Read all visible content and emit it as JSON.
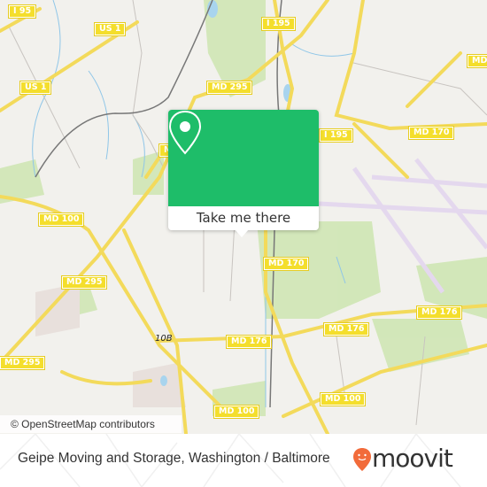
{
  "map": {
    "attribution": "© OpenStreetMap contributors",
    "road_labels": [
      {
        "id": "i95",
        "text": "I 95"
      },
      {
        "id": "us1-top",
        "text": "US 1"
      },
      {
        "id": "us1-left",
        "text": "US 1"
      },
      {
        "id": "md295-top",
        "text": "MD 295"
      },
      {
        "id": "i195-top",
        "text": "I 195"
      },
      {
        "id": "i195-mid",
        "text": "I 195"
      },
      {
        "id": "md170-right",
        "text": "MD 170"
      },
      {
        "id": "md-edge",
        "text": "MD"
      },
      {
        "id": "md-partial",
        "text": "M"
      },
      {
        "id": "md100-left",
        "text": "MD 100"
      },
      {
        "id": "md295-mid",
        "text": "MD 295"
      },
      {
        "id": "md170-center",
        "text": "MD 170"
      },
      {
        "id": "md176-right",
        "text": "MD 176"
      },
      {
        "id": "md176-mid",
        "text": "MD 176"
      },
      {
        "id": "md176-center",
        "text": "MD 176"
      },
      {
        "id": "md295-bottom",
        "text": "MD 295"
      },
      {
        "id": "md100-bottom-right",
        "text": "MD 100"
      },
      {
        "id": "md100-bottom",
        "text": "MD 100"
      }
    ],
    "exit_label": "10B"
  },
  "popup": {
    "button_label": "Take me there",
    "icon": "map-pin-icon",
    "color": "#1ebd69"
  },
  "footer": {
    "title": "Geipe Moving and Storage, Washington / Baltimore",
    "brand": "moovit",
    "brand_color": "#f26b3a"
  }
}
